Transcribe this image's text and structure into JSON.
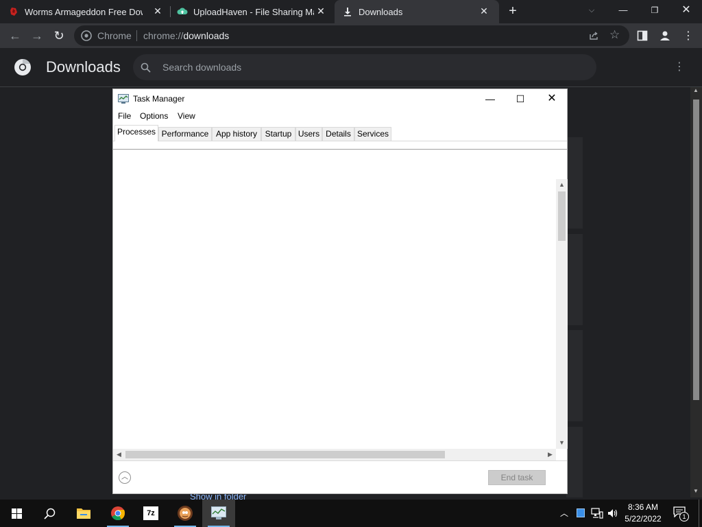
{
  "browser": {
    "tabs": [
      {
        "title": "Worms Armageddon Free Downl",
        "icon": "worms-favicon"
      },
      {
        "title": "UploadHaven - File Sharing Made",
        "icon": "uploadhaven-favicon"
      },
      {
        "title": "Downloads",
        "icon": "download-icon",
        "active": true
      }
    ],
    "new_tab_label": "+",
    "omnibox": {
      "scheme_label": "Chrome",
      "url_prefix": "chrome://",
      "url_host": "downloads"
    }
  },
  "downloads_page": {
    "title": "Downloads",
    "search_placeholder": "Search downloads",
    "show_in_folder": "Show in folder"
  },
  "task_manager": {
    "title": "Task Manager",
    "menu": [
      "File",
      "Options",
      "View"
    ],
    "tabs": [
      "Processes",
      "Performance",
      "App history",
      "Startup",
      "Users",
      "Details",
      "Services"
    ],
    "active_tab": "Processes",
    "end_task_label": "End task"
  },
  "taskbar": {
    "apps": [
      "start",
      "search",
      "file-explorer",
      "chrome",
      "7-zip",
      "worms-armageddon",
      "task-manager"
    ],
    "time": "8:36 AM",
    "date": "5/22/2022",
    "notification_count": "1"
  },
  "colors": {
    "chrome_dark": "#202124",
    "chrome_toolbar": "#35363a",
    "taskbar": "#101010",
    "accent": "#76b9ed"
  }
}
